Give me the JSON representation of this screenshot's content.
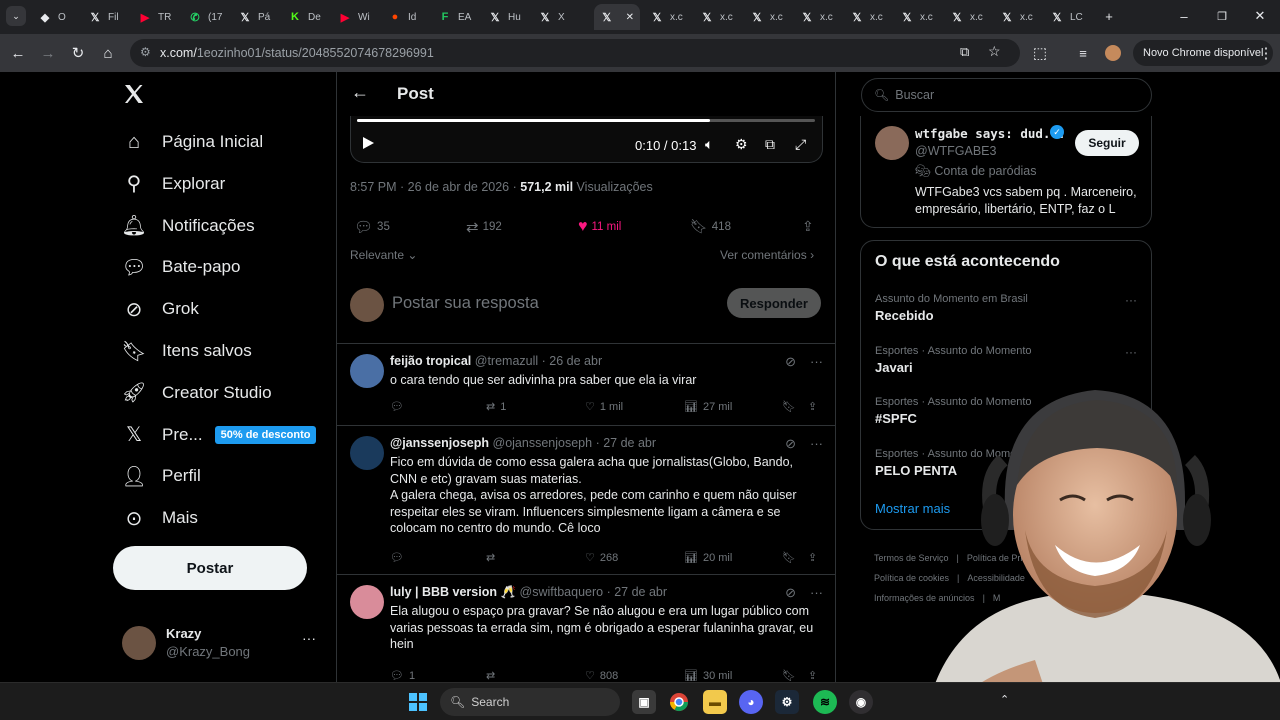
{
  "browser": {
    "tabs": [
      {
        "label": "O",
        "icon": "github-icon",
        "color": "#e8eaed"
      },
      {
        "label": "Fil",
        "icon": "x-logo-icon",
        "color": "#e8eaed"
      },
      {
        "label": "TR",
        "icon": "youtube-icon",
        "color": "#ff0033"
      },
      {
        "label": "(17",
        "icon": "whatsapp-icon",
        "color": "#25d366"
      },
      {
        "label": "Pá",
        "icon": "x-logo-icon",
        "color": "#e8eaed"
      },
      {
        "label": "De",
        "icon": "kick-icon",
        "color": "#53fc18"
      },
      {
        "label": "Wi",
        "icon": "youtube-icon",
        "color": "#ff0033"
      },
      {
        "label": "Id",
        "icon": "reddit-icon",
        "color": "#ff4500"
      },
      {
        "label": "EA",
        "icon": "fifa-icon",
        "color": "#22c55e"
      },
      {
        "label": "Hu",
        "icon": "x-logo-icon",
        "color": "#e8eaed"
      },
      {
        "label": "X",
        "icon": "x-logo-icon",
        "color": "#e8eaed"
      },
      {
        "label": "",
        "icon": "x-logo-icon",
        "color": "#e8eaed",
        "active": true
      },
      {
        "label": "x.c",
        "icon": "x-logo-icon",
        "color": "#e8eaed"
      },
      {
        "label": "x.c",
        "icon": "x-logo-icon",
        "color": "#e8eaed"
      },
      {
        "label": "x.c",
        "icon": "x-logo-icon",
        "color": "#e8eaed"
      },
      {
        "label": "x.c",
        "icon": "x-logo-icon",
        "color": "#e8eaed"
      },
      {
        "label": "x.c",
        "icon": "x-logo-icon",
        "color": "#e8eaed"
      },
      {
        "label": "x.c",
        "icon": "x-logo-icon",
        "color": "#e8eaed"
      },
      {
        "label": "x.c",
        "icon": "x-logo-icon",
        "color": "#e8eaed"
      },
      {
        "label": "x.c",
        "icon": "x-logo-icon",
        "color": "#e8eaed"
      },
      {
        "label": "LC",
        "icon": "x-logo-icon",
        "color": "#e8eaed"
      }
    ],
    "url_host": "x.com/",
    "url_path": "1eozinho01/status/2048552074678296991",
    "chrome_update": "Novo Chrome disponível"
  },
  "nav": {
    "items": [
      {
        "label": "Página Inicial",
        "icon": "home-icon"
      },
      {
        "label": "Explorar",
        "icon": "search-icon"
      },
      {
        "label": "Notificações",
        "icon": "bell-icon"
      },
      {
        "label": "Bate-papo",
        "icon": "chat-icon"
      },
      {
        "label": "Grok",
        "icon": "grok-icon"
      },
      {
        "label": "Itens salvos",
        "icon": "bookmark-icon"
      },
      {
        "label": "Creator Studio",
        "icon": "rocket-icon"
      },
      {
        "label": "Pre...",
        "icon": "x-logo-icon"
      },
      {
        "label": "Perfil",
        "icon": "person-icon"
      },
      {
        "label": "Mais",
        "icon": "more-circle-icon"
      }
    ],
    "promo": "50% de desconto",
    "post_button": "Postar",
    "account_name": "Krazy",
    "account_handle": "@Krazy_Bong"
  },
  "post": {
    "header": "Post",
    "video_time": "0:10 / 0:13",
    "video_progress": 0.77,
    "timestamp": "8:57 PM · 26 de abr de 2026 · ",
    "views_count": "571,2 mil",
    "views_label": " Visualizações",
    "replies": "35",
    "reposts": "192",
    "likes": "11 mil",
    "bookmarks": "418",
    "sort_label": "Relevante",
    "comments_link": "Ver comentários",
    "reply_placeholder": "Postar sua resposta",
    "reply_button": "Responder"
  },
  "replies": [
    {
      "name": "feijão tropical",
      "handle": "@tremazull",
      "date": "· 26 de abr",
      "text": "o cara tendo que ser adivinha pra saber que ela ia virar",
      "replies": "",
      "reposts": "1",
      "likes": "1 mil",
      "views": "27 mil",
      "avatar_color": "#4a6fa5"
    },
    {
      "name": "@janssenjoseph",
      "handle": "@ojanssenjoseph",
      "date": "· 27 de abr",
      "text": "Fico em dúvida de como essa galera acha que jornalistas(Globo, Bando, CNN e etc) gravam suas materias.\nA galera chega, avisa os arredores, pede com carinho e quem não quiser respeitar eles se viram. Influencers simplesmente ligam a câmera e se colocam no centro do mundo. Cê loco",
      "replies": "",
      "reposts": "",
      "likes": "268",
      "views": "20 mil",
      "avatar_color": "#1a3a5c"
    },
    {
      "name": "luly | BBB version 🥂",
      "handle": "@swiftbaquero",
      "date": "· 27 de abr",
      "text": "Ela alugou o espaço pra gravar? Se não alugou e era um lugar público com varias pessoas ta errada sim, ngm é obrigado a esperar fulaninha gravar, eu hein",
      "replies": "1",
      "reposts": "",
      "likes": "808",
      "views": "30 mil",
      "avatar_color": "#d98c9a"
    }
  ],
  "right": {
    "search_placeholder": "Buscar",
    "profile_name": "wtfgabe says: dud...",
    "profile_handle": "@WTFGABE3",
    "profile_label": "Conta de paródias",
    "profile_bio": "WTFGabe3 vcs sabem pq . Marceneiro, empresário, libertário, ENTP, faz o L",
    "follow_button": "Seguir",
    "trends_title": "O que está acontecendo",
    "trends": [
      {
        "category": "Assunto do Momento em Brasil",
        "name": "Recebido"
      },
      {
        "category": "Esportes · Assunto do Momento",
        "name": "Javari"
      },
      {
        "category": "Esportes · Assunto do Momento",
        "name": "#SPFC"
      },
      {
        "category": "Esportes · Assunto do Momento",
        "name": "PELO PENTA"
      }
    ],
    "show_more": "Mostrar mais",
    "footer": [
      "Termos de Serviço",
      "|",
      "Política de Privacidade",
      "Política de cookies",
      "|",
      "Acessibilidade",
      "Informações de anúncios",
      "|",
      "M"
    ]
  },
  "taskbar": {
    "search_label": "Search",
    "apps": [
      "windows-start-icon",
      "task-view-icon",
      "chrome-icon",
      "file-explorer-icon",
      "discord-icon",
      "steam-icon",
      "spotify-icon",
      "obs-icon"
    ]
  },
  "colors": {
    "accent": "#1d9bf0",
    "like": "#f91880",
    "verified": "#1d9bf0"
  }
}
